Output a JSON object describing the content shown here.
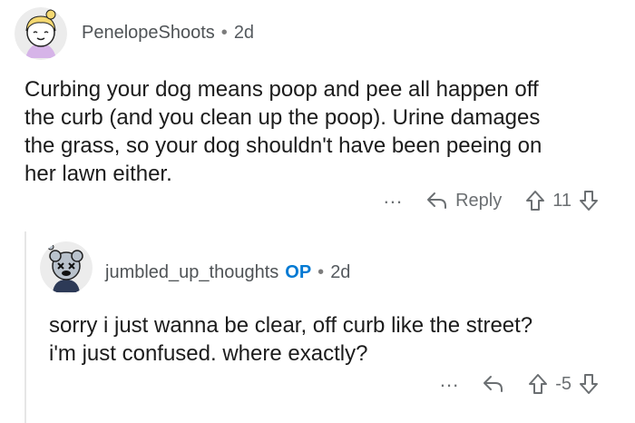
{
  "comments": [
    {
      "author": "PenelopeShoots",
      "age": "2d",
      "lines": [
        "Curbing your dog means poop and pee all happen off",
        "the curb (and you clean up the poop). Urine damages",
        "the grass, so your dog shouldn't have been peeing on",
        "her lawn either."
      ],
      "more": "...",
      "reply_label": "Reply",
      "score": "11"
    },
    {
      "author": "jumbled_up_thoughts",
      "badge": "OP",
      "age": "2d",
      "lines": [
        "sorry i just wanna be clear, off curb like the street?",
        "i'm just confused. where exactly?"
      ],
      "more": "...",
      "score": "-5"
    }
  ],
  "meta_separator": "•",
  "colors": {
    "op_badge": "#0079d3",
    "action_gray": "#6b6f72",
    "thread_line": "#e6e6e6"
  }
}
